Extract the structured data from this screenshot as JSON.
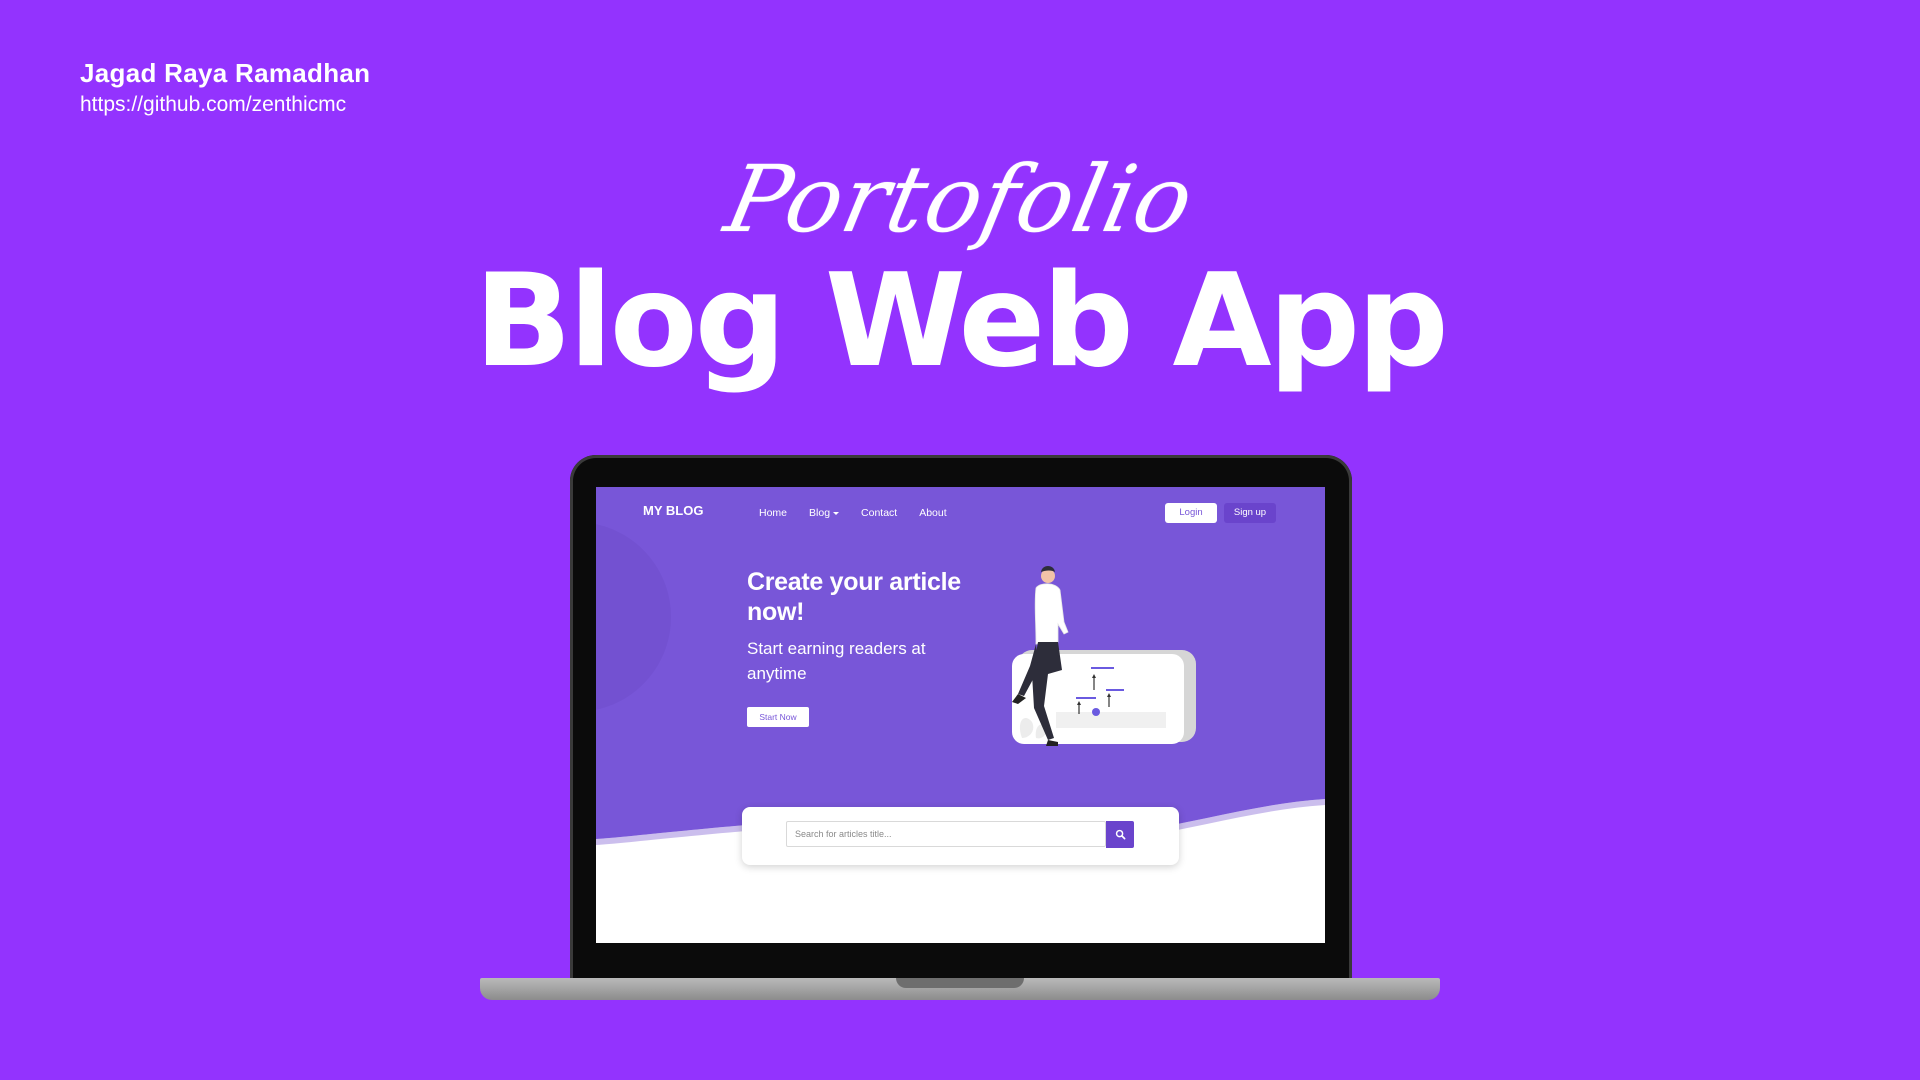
{
  "author": {
    "name": "Jagad Raya Ramadhan",
    "url": "https://github.com/zenthicmc"
  },
  "titles": {
    "script": "Portofolio",
    "main": "Blog Web App"
  },
  "app": {
    "brand": "MY BLOG",
    "nav": [
      {
        "label": "Home"
      },
      {
        "label": "Blog",
        "has_dropdown": true
      },
      {
        "label": "Contact"
      },
      {
        "label": "About"
      }
    ],
    "login_label": "Login",
    "signup_label": "Sign up",
    "hero": {
      "heading": "Create your article now!",
      "subheading": "Start earning readers at anytime",
      "cta_label": "Start Now"
    },
    "search": {
      "placeholder": "Search for articles title...",
      "icon": "search-icon"
    }
  },
  "colors": {
    "background": "#9333fe",
    "hero_purple": "#7856d8",
    "accent_purple": "#6a44cc",
    "laptop_bezel": "#0b0b0b",
    "laptop_base": "#a6a6a6"
  }
}
